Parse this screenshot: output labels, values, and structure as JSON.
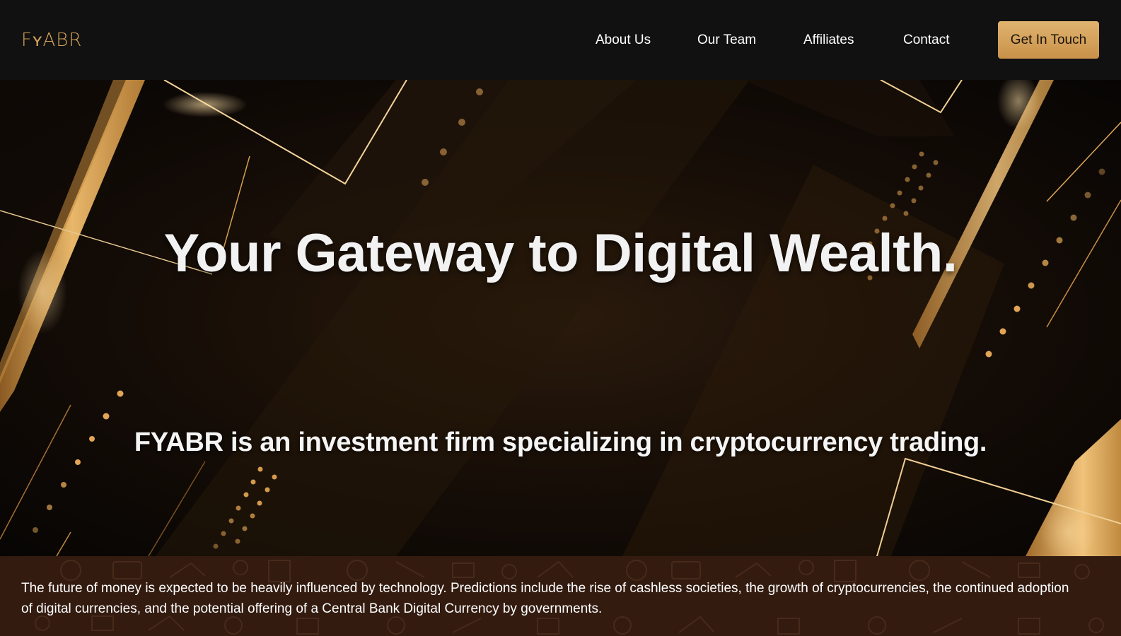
{
  "brand": {
    "logo_text": "FʏABR",
    "accent_color": "#d4a25a"
  },
  "nav": {
    "items": [
      {
        "label": "About Us"
      },
      {
        "label": "Our Team"
      },
      {
        "label": "Affiliates"
      },
      {
        "label": "Contact"
      }
    ],
    "cta_label": "Get In Touch"
  },
  "hero": {
    "title": "Your Gateway to Digital Wealth.",
    "subtitle": "FYABR is an investment firm specializing in cryptocurrency trading."
  },
  "info": {
    "text": "The future of money is expected to be heavily influenced by technology. Predictions include the rise of cashless societies, the growth of cryptocurrencies, the continued adoption of digital currencies, and the potential offering of a Central Bank Digital Currency by governments."
  },
  "colors": {
    "nav_background": "#111111",
    "cta_gold": "#d6a660",
    "band_background": "#331b10"
  }
}
